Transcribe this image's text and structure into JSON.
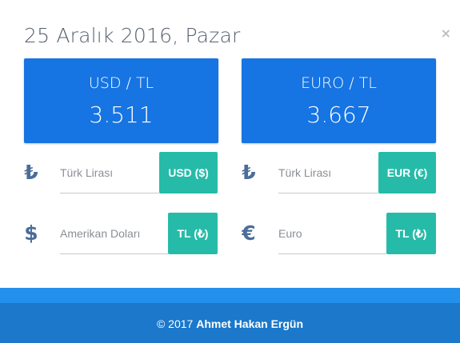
{
  "header": {
    "date_title": "25 Aralık 2016, Pazar",
    "close_label": "×"
  },
  "rates": {
    "usd": {
      "pair": "USD / TL",
      "value": "3.511"
    },
    "eur": {
      "pair": "EURO / TL",
      "value": "3.667"
    }
  },
  "converters": {
    "left": {
      "row1": {
        "icon": "₺",
        "icon_name": "turkish-lira-icon",
        "value": "",
        "placeholder": "Türk Lirası",
        "button": "USD ($)"
      },
      "row2": {
        "icon": "$",
        "icon_name": "dollar-icon",
        "value": "",
        "placeholder": "Amerikan Doları",
        "button": "TL (₺)"
      }
    },
    "right": {
      "row1": {
        "icon": "₺",
        "icon_name": "turkish-lira-icon",
        "value": "",
        "placeholder": "Türk Lirası",
        "button": "EUR (€)"
      },
      "row2": {
        "icon": "€",
        "icon_name": "euro-icon",
        "value": "",
        "placeholder": "Euro",
        "button": "TL (₺)"
      }
    }
  },
  "footer": {
    "copyright": "© 2017",
    "author": "Ahmet Hakan Ergün"
  },
  "colors": {
    "card_blue": "#1674e3",
    "button_teal": "#26bba8",
    "icon_blue": "#4a6d99",
    "footer_blue": "#1b78cb",
    "footer_strip": "#2391ec"
  }
}
